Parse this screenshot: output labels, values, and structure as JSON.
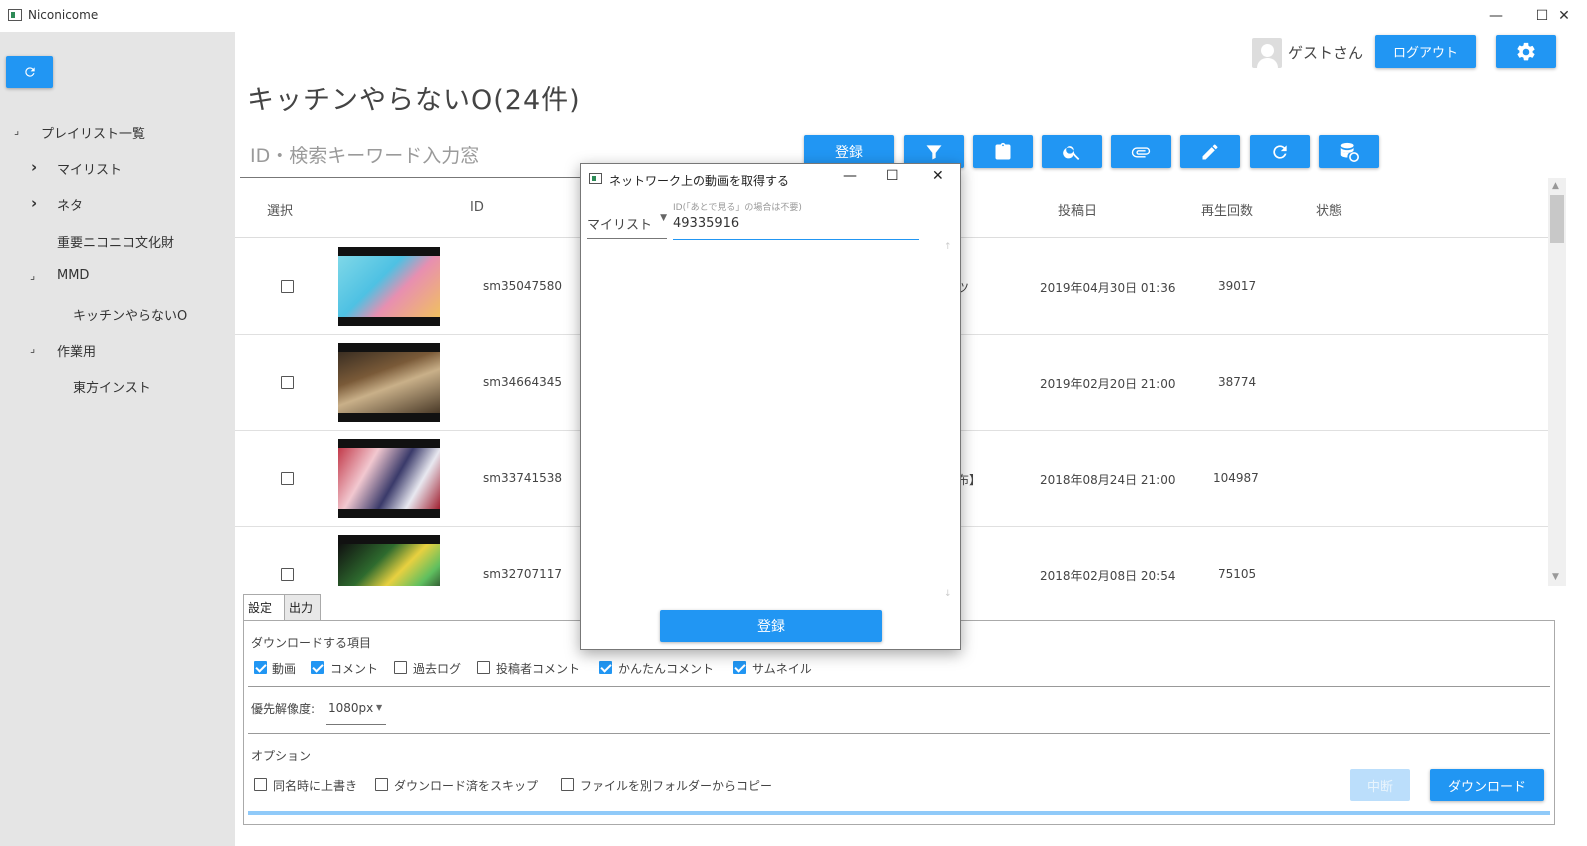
{
  "window": {
    "title": "Niconicome",
    "minimize": "—",
    "maximize": "☐",
    "close": "✕"
  },
  "sidebar": {
    "refresh_icon": "refresh-icon",
    "tree": [
      {
        "label": "プレイリスト一覧",
        "arrow": "⌟"
      },
      {
        "label": "マイリスト",
        "arrow": "›"
      },
      {
        "label": "ネタ",
        "arrow": "›"
      },
      {
        "label": "重要ニコニコ文化財",
        "arrow": ""
      },
      {
        "label": "MMD",
        "arrow": "⌟"
      },
      {
        "label": "キッチンやらないO",
        "arrow": ""
      },
      {
        "label": "作業用",
        "arrow": "⌟"
      },
      {
        "label": "東方インスト",
        "arrow": ""
      }
    ]
  },
  "header": {
    "title": "キッチンやらないO(24件)",
    "user": "ゲストさん",
    "logout": "ログアウト",
    "settings_icon": "gear-icon"
  },
  "toolbar": {
    "search_placeholder": "ID・検索キーワード入力窓",
    "register": "登録",
    "icons": [
      "filter-icon",
      "clipboard-icon",
      "search-icon",
      "attach-icon",
      "edit-icon",
      "refresh-icon",
      "database-sync-icon"
    ]
  },
  "table": {
    "headers": {
      "select": "選択",
      "id": "ID",
      "posted": "投稿日",
      "views": "再生回数",
      "status": "状態"
    },
    "rows": [
      {
        "id": "sm35047580",
        "title_tail": "カツ",
        "posted": "2019年04月30日 01:36",
        "views": "39017"
      },
      {
        "id": "sm34664345",
        "title_tail": "",
        "posted": "2019年02月20日 21:00",
        "views": "38774"
      },
      {
        "id": "sm33741538",
        "title_tail": "配布】",
        "posted": "2018年08月24日 21:00",
        "views": "104987"
      },
      {
        "id": "sm32707117",
        "title_tail": "",
        "posted": "2018年02月08日 20:54",
        "views": "75105"
      }
    ]
  },
  "bottom": {
    "tabs": [
      "設定",
      "出力"
    ],
    "download_items_label": "ダウンロードする項目",
    "items": [
      {
        "label": "動画",
        "checked": true
      },
      {
        "label": "コメント",
        "checked": true
      },
      {
        "label": "過去ログ",
        "checked": false
      },
      {
        "label": "投稿者コメント",
        "checked": false
      },
      {
        "label": "かんたんコメント",
        "checked": true
      },
      {
        "label": "サムネイル",
        "checked": true
      }
    ],
    "resolution_label": "優先解像度:",
    "resolution_value": "1080px",
    "options_label": "オプション",
    "options": [
      {
        "label": "同名時に上書き",
        "checked": false
      },
      {
        "label": "ダウンロード済をスキップ",
        "checked": false
      },
      {
        "label": "ファイルを別フォルダーからコピー",
        "checked": false
      }
    ],
    "abort": "中断",
    "download": "ダウンロード"
  },
  "dialog": {
    "title": "ネットワーク上の動画を取得する",
    "source_select": "マイリスト",
    "id_hint": "ID(「あとで見る」の場合は不要)",
    "id_value": "49335916",
    "register": "登録",
    "minimize": "—",
    "maximize": "☐",
    "close": "✕"
  },
  "colors": {
    "accent": "#2196f3",
    "sidebar_bg": "#e5e5e5",
    "abort_disabled": "#bbdefb"
  }
}
